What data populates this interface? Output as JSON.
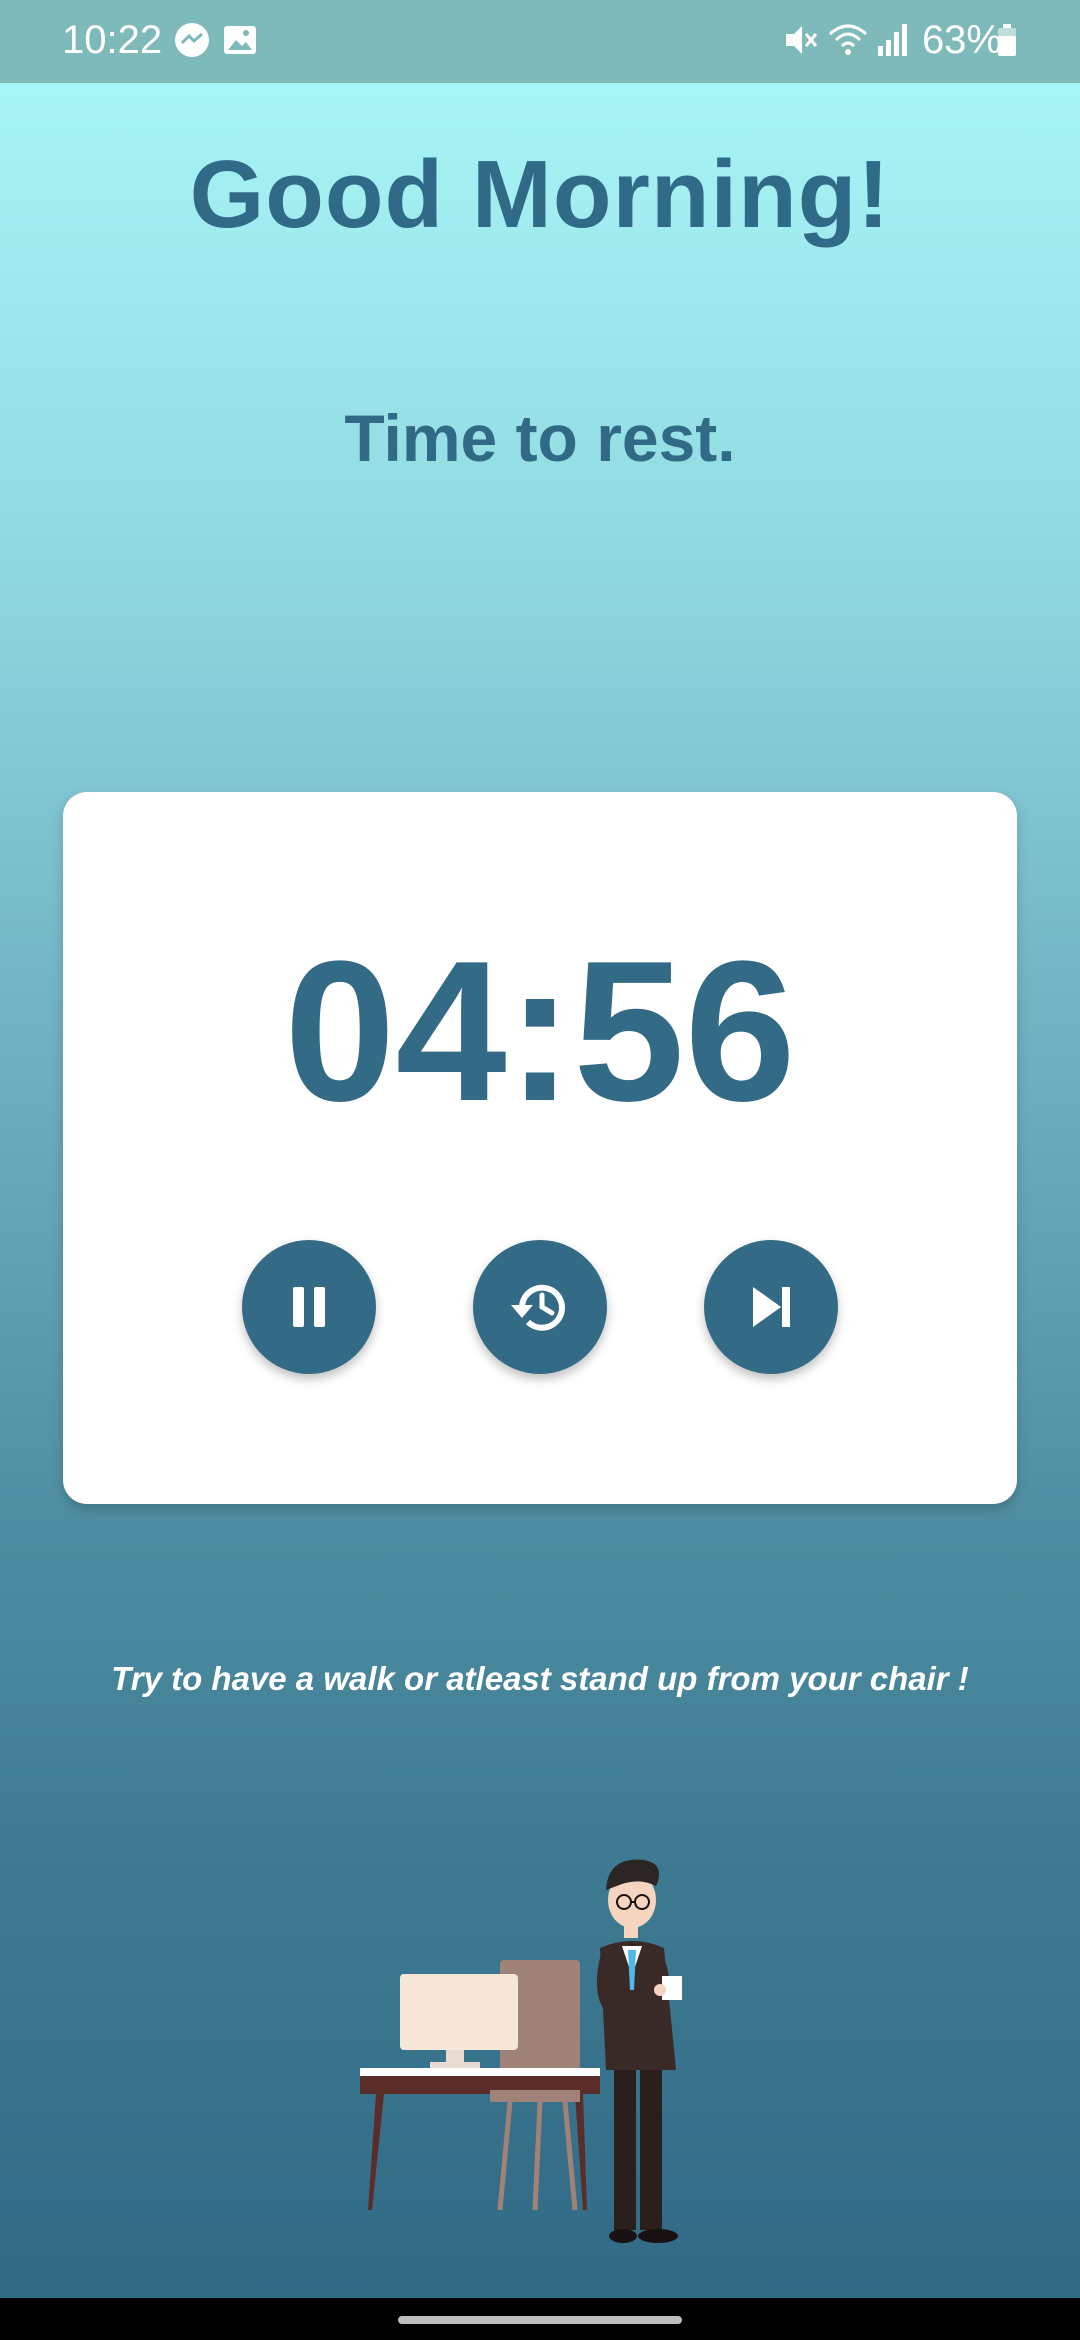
{
  "status_bar": {
    "time": "10:22",
    "battery": "63%",
    "icons": [
      "messenger-icon",
      "gallery-icon",
      "mute-icon",
      "wifi-icon",
      "signal-icon",
      "battery-icon"
    ]
  },
  "greeting": "Good Morning!",
  "subtitle": "Time to rest.",
  "timer": {
    "value": "04:56",
    "controls": [
      "pause-icon",
      "restart-icon",
      "skip-icon"
    ]
  },
  "tip": "Try to have a walk or atleast stand up from your chair !",
  "colors": {
    "accent": "#336b87",
    "status_bar": "#7fbabb",
    "card": "#ffffff"
  }
}
